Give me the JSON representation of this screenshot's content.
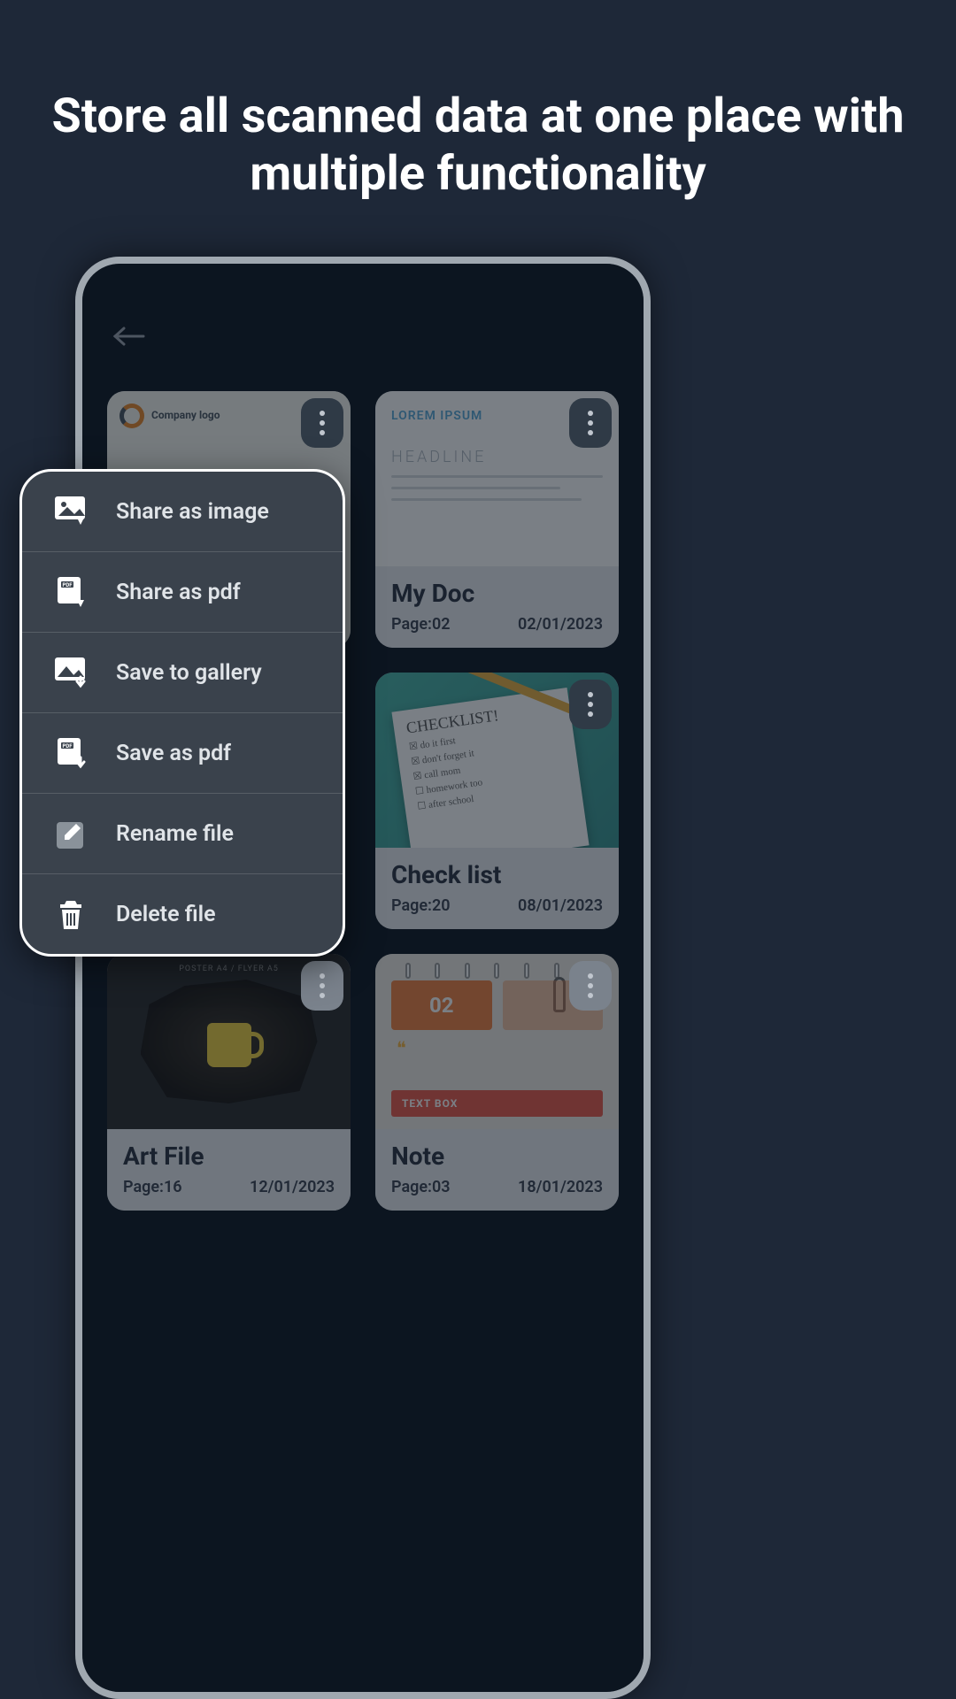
{
  "headline": "Store all scanned data at one place with multiple functionality",
  "thumbLabels": {
    "companyLogo": "Company logo",
    "lorem": "LOREM IPSUM",
    "headline": "HEADLINE",
    "checklist": "CHECKLIST!",
    "poster": "POSTER A4 / FLYER A5",
    "textbox": "TEXT BOX"
  },
  "cards": [
    {
      "title": "My Doc",
      "pageLabel": "Page:02",
      "date": "02/01/2023"
    },
    {
      "title": "Check list",
      "pageLabel": "Page:20",
      "date": "08/01/2023"
    },
    {
      "title": "Art File",
      "pageLabel": "Page:16",
      "date": "12/01/2023"
    },
    {
      "title": "Note",
      "pageLabel": "Page:03",
      "date": "18/01/2023"
    }
  ],
  "menu": {
    "shareImage": "Share as image",
    "sharePdf": "Share as pdf",
    "saveGallery": "Save to gallery",
    "savePdf": "Save as pdf",
    "rename": "Rename file",
    "delete": "Delete file"
  }
}
